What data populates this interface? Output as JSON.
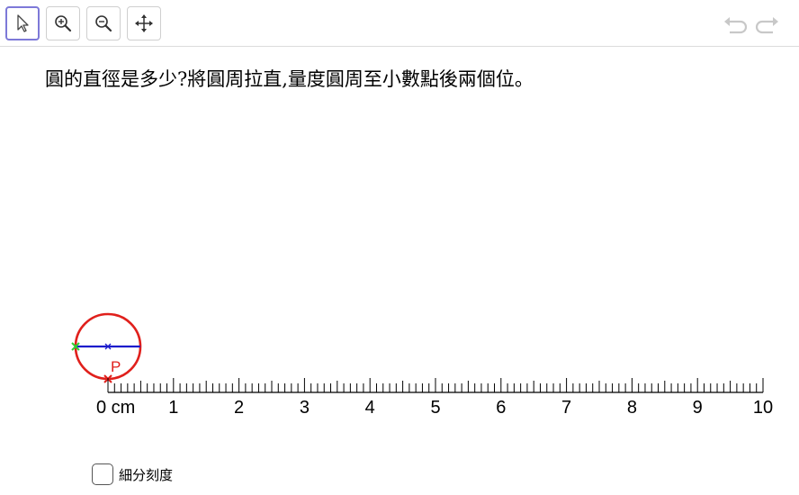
{
  "toolbar": {
    "tools": [
      {
        "name": "move-tool",
        "icon": "arrow-cursor-icon",
        "active": true
      },
      {
        "name": "zoom-in-tool",
        "icon": "zoom-in-icon",
        "active": false
      },
      {
        "name": "zoom-out-tool",
        "icon": "zoom-out-icon",
        "active": false
      },
      {
        "name": "move-graphics-view-tool",
        "icon": "four-way-arrow-icon",
        "active": false
      }
    ],
    "undo_icon": "undo-icon",
    "redo_icon": "redo-icon",
    "active_color": "#7d79d8"
  },
  "question": "圓的直徑是多少?將圓周拉直,量度圓周至小數點後兩個位。",
  "ruler": {
    "labels": [
      "0 cm",
      "1",
      "2",
      "3",
      "4",
      "5",
      "6",
      "7",
      "8",
      "9",
      "10"
    ],
    "min": 0,
    "max": 10,
    "minor_divisions_per_unit": 10
  },
  "circle": {
    "point_label": "P",
    "circle_color": "#e0201c",
    "diameter_color": "#1c1ccc",
    "left_point_color": "#33cc33"
  },
  "options": {
    "fine_scale_label": "細分刻度",
    "fine_scale_checked": false
  }
}
